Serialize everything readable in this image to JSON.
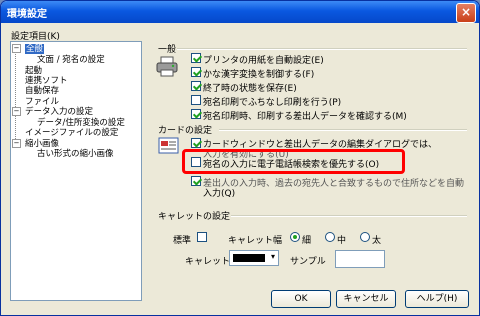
{
  "window": {
    "title": "環境設定",
    "close_symbol": "×"
  },
  "settings_list": {
    "label": "設定項目(K)",
    "items": [
      {
        "label": "全般",
        "selected": true
      },
      {
        "label": "文面 / 宛名の設定"
      },
      {
        "label": "起動"
      },
      {
        "label": "連携ソフト"
      },
      {
        "label": "自動保存"
      },
      {
        "label": "ファイル"
      },
      {
        "label": "データ入力の設定"
      },
      {
        "label": "データ/住所変換の設定"
      },
      {
        "label": "イメージファイルの設定"
      },
      {
        "label": "縮小画像"
      },
      {
        "label": "古い形式の縮小画像"
      }
    ]
  },
  "general": {
    "heading": "一般",
    "options": [
      {
        "label": "プリンタの用紙を自動設定(E)",
        "checked": true
      },
      {
        "label": "かな漢字変換を制御する(F)",
        "checked": true
      },
      {
        "label": "終了時の状態を保存(E)",
        "checked": true
      },
      {
        "label": "宛名印刷でふちなし印刷を行う(P)",
        "checked": false
      },
      {
        "label": "宛名印刷時、印刷する差出人データを確認する(M)",
        "checked": true
      }
    ]
  },
  "card": {
    "heading": "カードの設定",
    "options": [
      {
        "label": "カードウィンドウと差出人データの編集ダイアログでは、",
        "checked": true
      },
      {
        "label": "宛名の入力に電子電話帳検索を優先する(O)",
        "checked": false
      },
      {
        "label": "差出人の入力時、過去の宛先人と合致するもので住所などを自動",
        "checked": true
      }
    ],
    "option1_cont": "入力を有効にする(U)",
    "option3_cont": "入力(Q)"
  },
  "caret": {
    "heading": "キャレットの設定",
    "standard_label": "標準",
    "width_label": "キャレット幅",
    "widths": [
      {
        "label": "細",
        "selected": true
      },
      {
        "label": "中",
        "selected": false
      },
      {
        "label": "太",
        "selected": false
      }
    ],
    "color_label": "キャレット色",
    "color_value": "#000000",
    "sample_label": "サンプル"
  },
  "buttons": {
    "ok": "OK",
    "cancel": "キャンセル",
    "help": "ヘルプ(H)"
  },
  "annotation": {
    "highlight_color": "#ff0000"
  }
}
